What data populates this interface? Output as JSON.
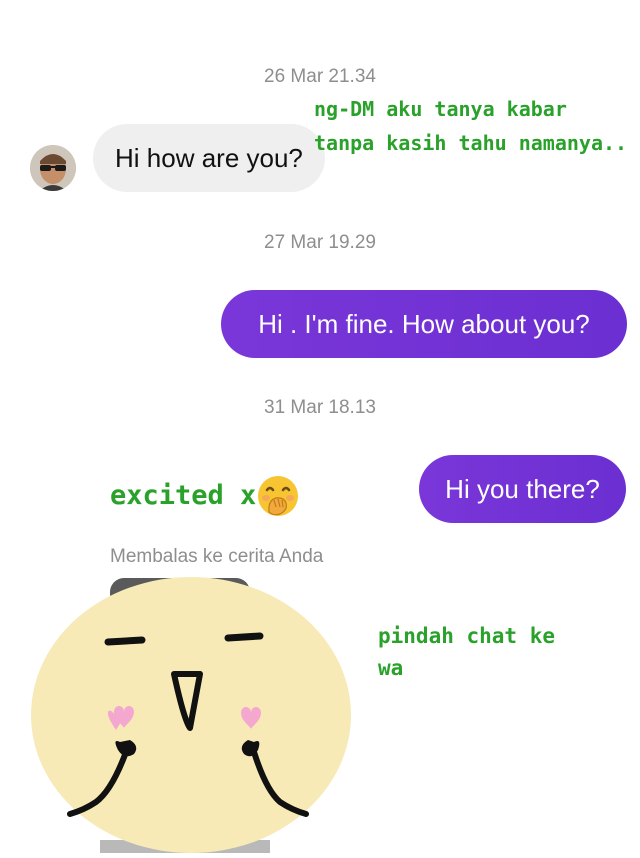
{
  "timestamps": [
    "26 Mar 21.34",
    "27 Mar 19.29",
    "31 Mar 18.13"
  ],
  "messages": {
    "incoming_1": "Hi how are you?",
    "outgoing_1": "Hi . I'm fine. How about you?",
    "outgoing_2": "Hi you there?"
  },
  "annotations": {
    "note_1_line1": "ng-DM aku tanya kabar",
    "note_1_line2": "tanpa kasih tahu namanya..",
    "note_2": "excited x",
    "note_3_line1": "pindah chat ke",
    "note_3_line2": "wa"
  },
  "reply_caption": "Membalas ke cerita Anda",
  "colors": {
    "outgoing_bubble": "#6b2fd2",
    "incoming_bubble": "#efefef",
    "annotation_text": "#2aa12a",
    "timestamp_text": "#8e8e8e"
  },
  "icons": {
    "avatar": "profile-photo",
    "emoji": "hand-over-mouth-face-emoji",
    "story_sticker": "smiling-face-finger-hearts-doodle"
  }
}
